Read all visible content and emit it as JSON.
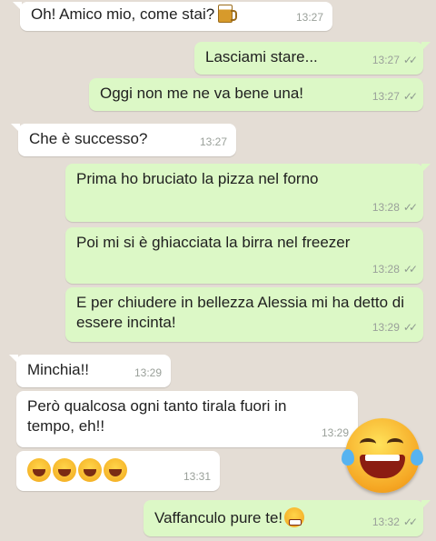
{
  "colors": {
    "background": "#e4ddd5",
    "incoming": "#ffffff",
    "outgoing": "#dcf8c6",
    "time": "#9aa09a"
  },
  "messages": [
    {
      "direction": "in",
      "text": "Oh! Amico mio, come stai?",
      "time": "13:27",
      "emoji": "beer-icon"
    },
    {
      "direction": "out",
      "text": "Lasciami stare...",
      "time": "13:27",
      "status": "read"
    },
    {
      "direction": "out",
      "text": "Oggi non me ne va bene una!",
      "time": "13:27",
      "status": "read"
    },
    {
      "direction": "in",
      "text": "Che è successo?",
      "time": "13:27"
    },
    {
      "direction": "out",
      "text": "Prima ho bruciato la pizza nel forno",
      "time": "13:28",
      "status": "read"
    },
    {
      "direction": "out",
      "text": "Poi mi si è ghiacciata la birra nel freezer",
      "time": "13:28",
      "status": "read"
    },
    {
      "direction": "out",
      "text": "E per chiudere in bellezza Alessia mi ha detto di essere incinta!",
      "time": "13:29",
      "status": "read"
    },
    {
      "direction": "in",
      "text": "Minchia!!",
      "time": "13:29"
    },
    {
      "direction": "in",
      "text": "Però qualcosa ogni tanto tirala fuori in tempo, eh!!",
      "time": "13:29"
    },
    {
      "direction": "in",
      "text": "",
      "time": "13:31",
      "emoji": "laughing-emoji-x4"
    },
    {
      "direction": "out",
      "text": "Vaffanculo pure te!",
      "time": "13:32",
      "status": "read",
      "emoji": "angry-face-icon"
    }
  ],
  "overlay": {
    "sticker": "big-laughing-emoji"
  }
}
